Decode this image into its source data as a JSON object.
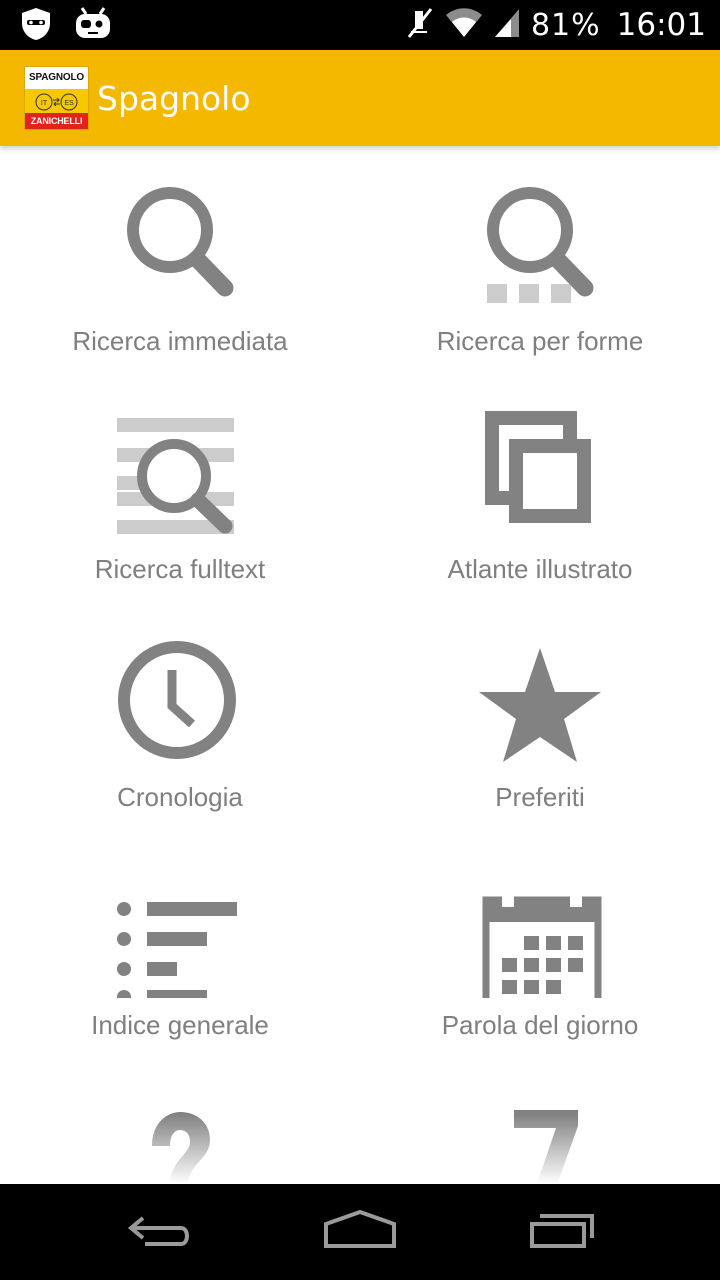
{
  "status_bar": {
    "battery": "81%",
    "time": "16:01",
    "icons": [
      "privacy-guard-icon",
      "cyanogen-mascot-icon",
      "mute-icon",
      "wifi-icon",
      "signal-icon"
    ]
  },
  "app_bar": {
    "title": "Spagnolo",
    "logo": {
      "top_text": "SPAGNOLO",
      "left_badge": "IT",
      "right_badge": "ES",
      "bottom_text": "ZANICHELLI"
    }
  },
  "menu": {
    "items": [
      {
        "label": "Ricerca immediata",
        "icon": "search-icon"
      },
      {
        "label": "Ricerca per forme",
        "icon": "search-forms-icon"
      },
      {
        "label": "Ricerca fulltext",
        "icon": "fulltext-search-icon"
      },
      {
        "label": "Atlante illustrato",
        "icon": "gallery-icon"
      },
      {
        "label": "Cronologia",
        "icon": "clock-icon"
      },
      {
        "label": "Preferiti",
        "icon": "star-icon"
      },
      {
        "label": "Indice generale",
        "icon": "list-icon"
      },
      {
        "label": "Parola del giorno",
        "icon": "calendar-icon"
      },
      {
        "label": "",
        "icon": "help-icon"
      },
      {
        "label": "",
        "icon": "seven-icon"
      }
    ]
  },
  "colors": {
    "accent": "#f4b800",
    "icon": "#828282",
    "icon_light": "#cccccc",
    "label": "#7f7f7f"
  },
  "nav_bar": {
    "icons": [
      "back-icon",
      "home-icon",
      "recent-apps-icon"
    ]
  }
}
